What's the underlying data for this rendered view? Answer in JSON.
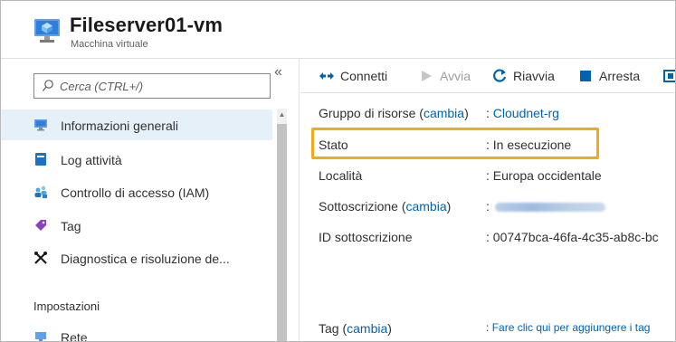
{
  "header": {
    "title": "Fileserver01-vm",
    "subtitle": "Macchina virtuale",
    "icon": "virtual-machine-icon"
  },
  "sidebar": {
    "search_placeholder": "Cerca (CTRL+/)",
    "collapse_glyph": "«",
    "items": [
      {
        "label": "Informazioni generali",
        "icon": "monitor-icon",
        "selected": true
      },
      {
        "label": "Log attività",
        "icon": "activity-log-icon"
      },
      {
        "label": "Controllo di accesso (IAM)",
        "icon": "iam-users-icon"
      },
      {
        "label": "Tag",
        "icon": "tag-icon"
      },
      {
        "label": "Diagnostica e risoluzione de...",
        "icon": "wrench-icon"
      }
    ],
    "section_heading": "Impostazioni",
    "section_items": [
      {
        "label": "Rete",
        "icon": "network-icon"
      }
    ]
  },
  "toolbar": {
    "buttons": [
      {
        "label": "Connetti",
        "icon": "connect-icon",
        "enabled": true
      },
      {
        "label": "Avvia",
        "icon": "play-icon",
        "enabled": false
      },
      {
        "label": "Riavvia",
        "icon": "restart-icon",
        "enabled": true
      },
      {
        "label": "Arresta",
        "icon": "stop-icon",
        "enabled": true
      }
    ]
  },
  "essentials": {
    "resource_group_label": "Gruppo di risorse (",
    "resource_group_link": "cambia",
    "resource_group_close": ")",
    "resource_group_value": "Cloudnet-rg",
    "status_label": "Stato",
    "status_value": "In esecuzione",
    "location_label": "Località",
    "location_value": "Europa occidentale",
    "subscription_label": "Sottoscrizione (",
    "subscription_link": "cambia",
    "subscription_close": ")",
    "subscription_id_label": "ID sottoscrizione",
    "subscription_id_value": "00747bca-46fa-4c35-ab8c-bc",
    "tag_label": "Tag (",
    "tag_link": "cambia",
    "tag_close": ")",
    "tag_value": "Fare clic qui per aggiungere i tag",
    "separator": ":"
  },
  "colors": {
    "accent": "#0063b1",
    "highlight": "#f2a91e",
    "selected_bg": "#e6f0f8"
  }
}
